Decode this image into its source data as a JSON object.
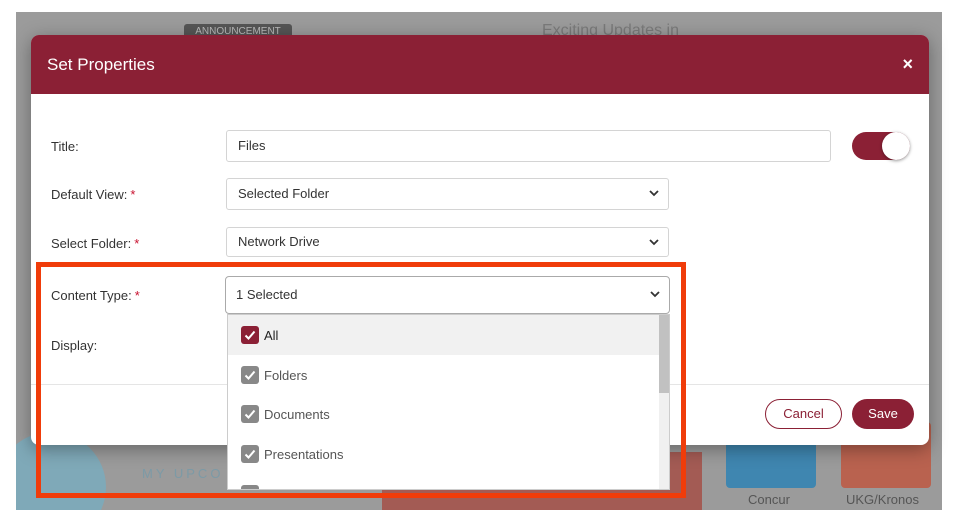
{
  "background": {
    "badge": "ANNOUNCEMENT",
    "announcement_title": "Exciting Updates in",
    "upcoming_label": "MY UPCO",
    "tiles": [
      "Concur",
      "UKG/Kronos"
    ]
  },
  "modal": {
    "title": "Set Properties",
    "close": "×",
    "fields": {
      "title_label": "Title:",
      "title_value": "Files",
      "title_toggle_on": true,
      "default_view_label": "Default View:",
      "default_view_value": "Selected Folder",
      "select_folder_label": "Select Folder:",
      "select_folder_value": "Network Drive",
      "content_type_label": "Content Type:",
      "content_type_value": "1 Selected",
      "display_label": "Display:",
      "required_mark": "*"
    },
    "content_type_options": [
      {
        "label": "All",
        "checked": true,
        "active": true
      },
      {
        "label": "Folders",
        "checked": true,
        "active": false
      },
      {
        "label": "Documents",
        "checked": true,
        "active": false
      },
      {
        "label": "Presentations",
        "checked": true,
        "active": false
      }
    ],
    "buttons": {
      "cancel": "Cancel",
      "save": "Save"
    }
  },
  "colors": {
    "brand": "#8b2035",
    "highlight": "#f03c0a"
  }
}
